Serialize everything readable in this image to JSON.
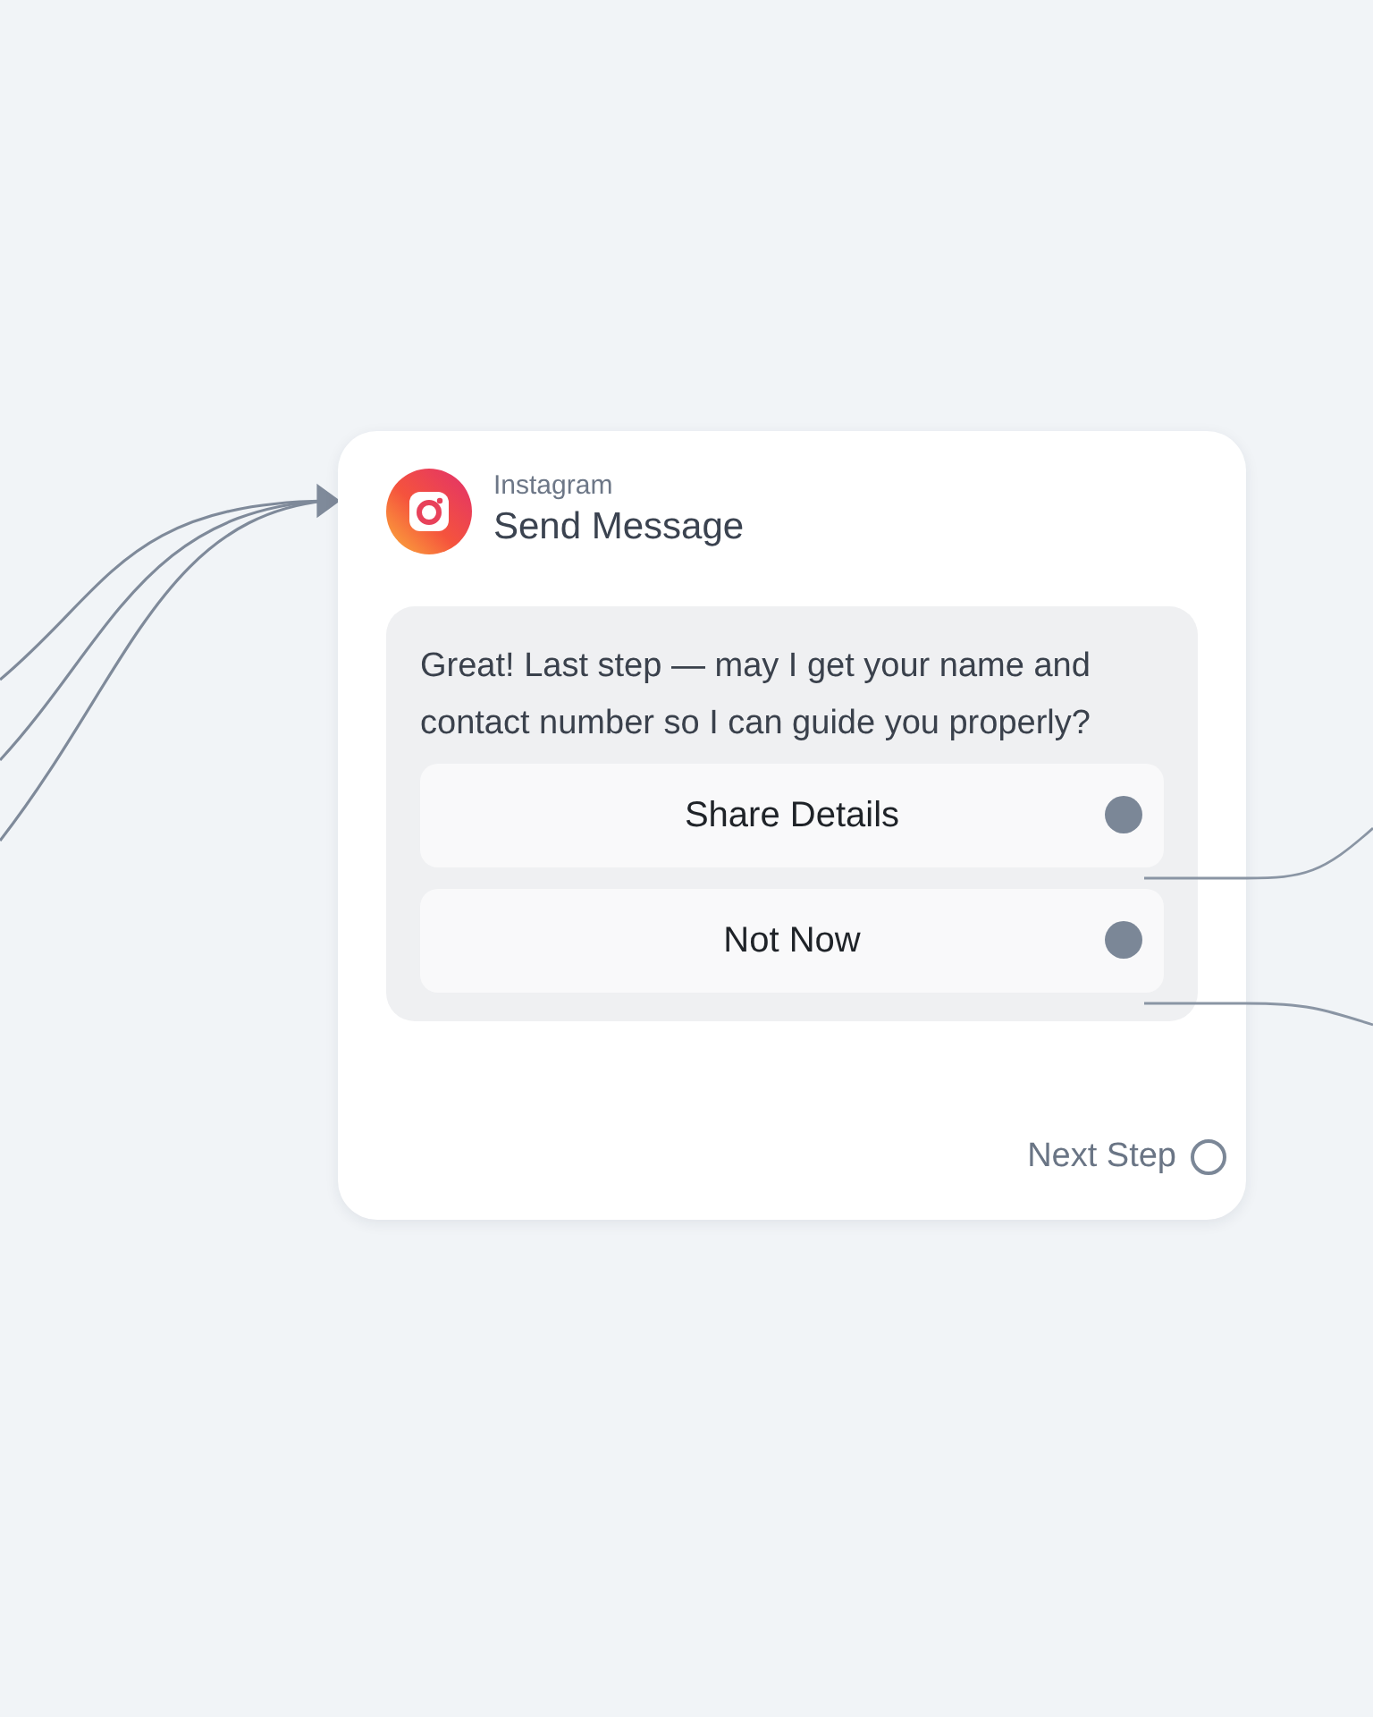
{
  "node": {
    "platform": "Instagram",
    "title": "Send Message",
    "message": "Great! Last step — may I get your name and contact number so I can guide you properly?",
    "buttons": [
      {
        "label": "Share Details",
        "connected": true
      },
      {
        "label": "Not Now",
        "connected": true
      }
    ],
    "next_step": {
      "label": "Next Step",
      "connected": false
    }
  }
}
